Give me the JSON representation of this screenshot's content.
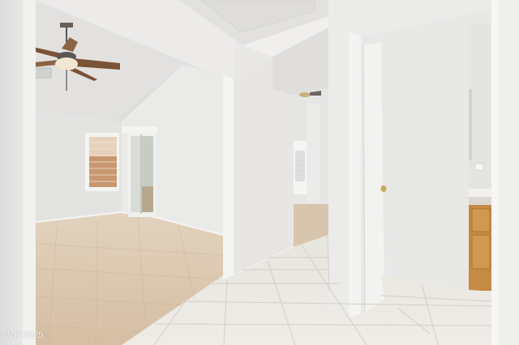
{
  "watermark": {
    "text": "LVR 2025"
  },
  "palette": {
    "wall": "#ebeae8",
    "ceiling": "#e4e3e1",
    "trim": "#f2f2f0",
    "tile_floor": "#e7e4de",
    "wood_floor": "#d9c6ae",
    "cabinet": "#c58a45"
  }
}
